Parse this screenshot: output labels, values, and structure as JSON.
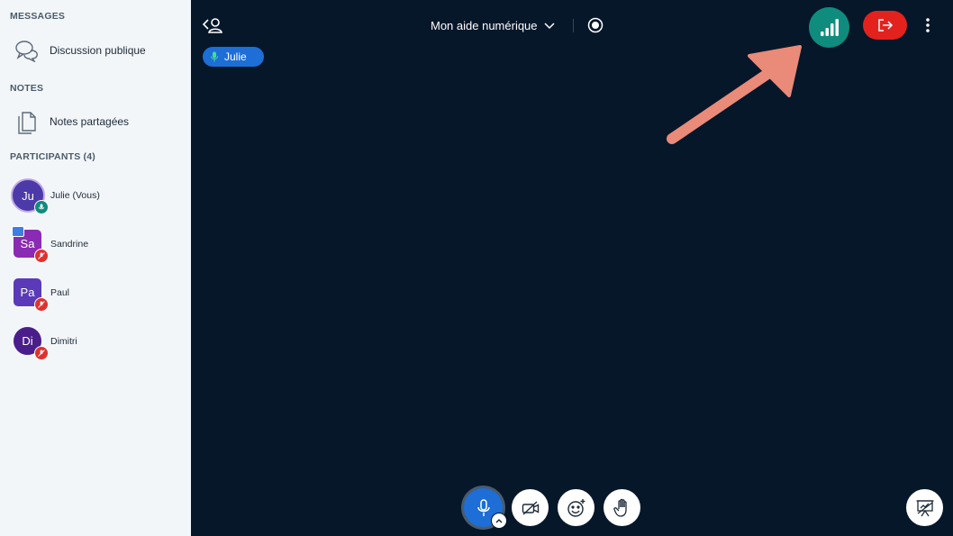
{
  "sidebar": {
    "messages_title": "MESSAGES",
    "public_chat_label": "Discussion publique",
    "notes_title": "NOTES",
    "shared_notes_label": "Notes partagées",
    "participants_title": "PARTICIPANTS (4)",
    "participants": [
      {
        "initials": "Ju",
        "name": "Julie (Vous)",
        "color": "#4c3aa8",
        "mic": "on"
      },
      {
        "initials": "Sa",
        "name": "Sandrine",
        "color": "#8a2bb3",
        "mic": "muted",
        "presenter": true
      },
      {
        "initials": "Pa",
        "name": "Paul",
        "color": "#5a3ab8",
        "mic": "muted"
      },
      {
        "initials": "Di",
        "name": "Dimitri",
        "color": "#4a1e8a",
        "mic": "muted"
      }
    ]
  },
  "header": {
    "meeting_title": "Mon aide numérique",
    "talking_indicator": "Julie"
  },
  "icons": {
    "toggle_userlist": "user-list-toggle-icon",
    "dropdown": "chevron-down-icon",
    "record": "record-icon",
    "connection": "connection-status-icon",
    "leave": "leave-icon",
    "options": "kebab-menu-icon",
    "mic": "microphone-icon",
    "camera": "camera-off-icon",
    "reactions": "emoji-icon",
    "raise_hand": "hand-icon",
    "presentation": "presentation-icon"
  },
  "colors": {
    "background": "#06172a",
    "sidebar": "#f3f6f9",
    "connection_ok": "#0f8c7e",
    "leave_red": "#e3221e",
    "mic_active": "#1d6ed6",
    "muted_red": "#e0312f",
    "mic_on_badge": "#0f8c7e",
    "annotation_arrow": "#ea8a78"
  }
}
